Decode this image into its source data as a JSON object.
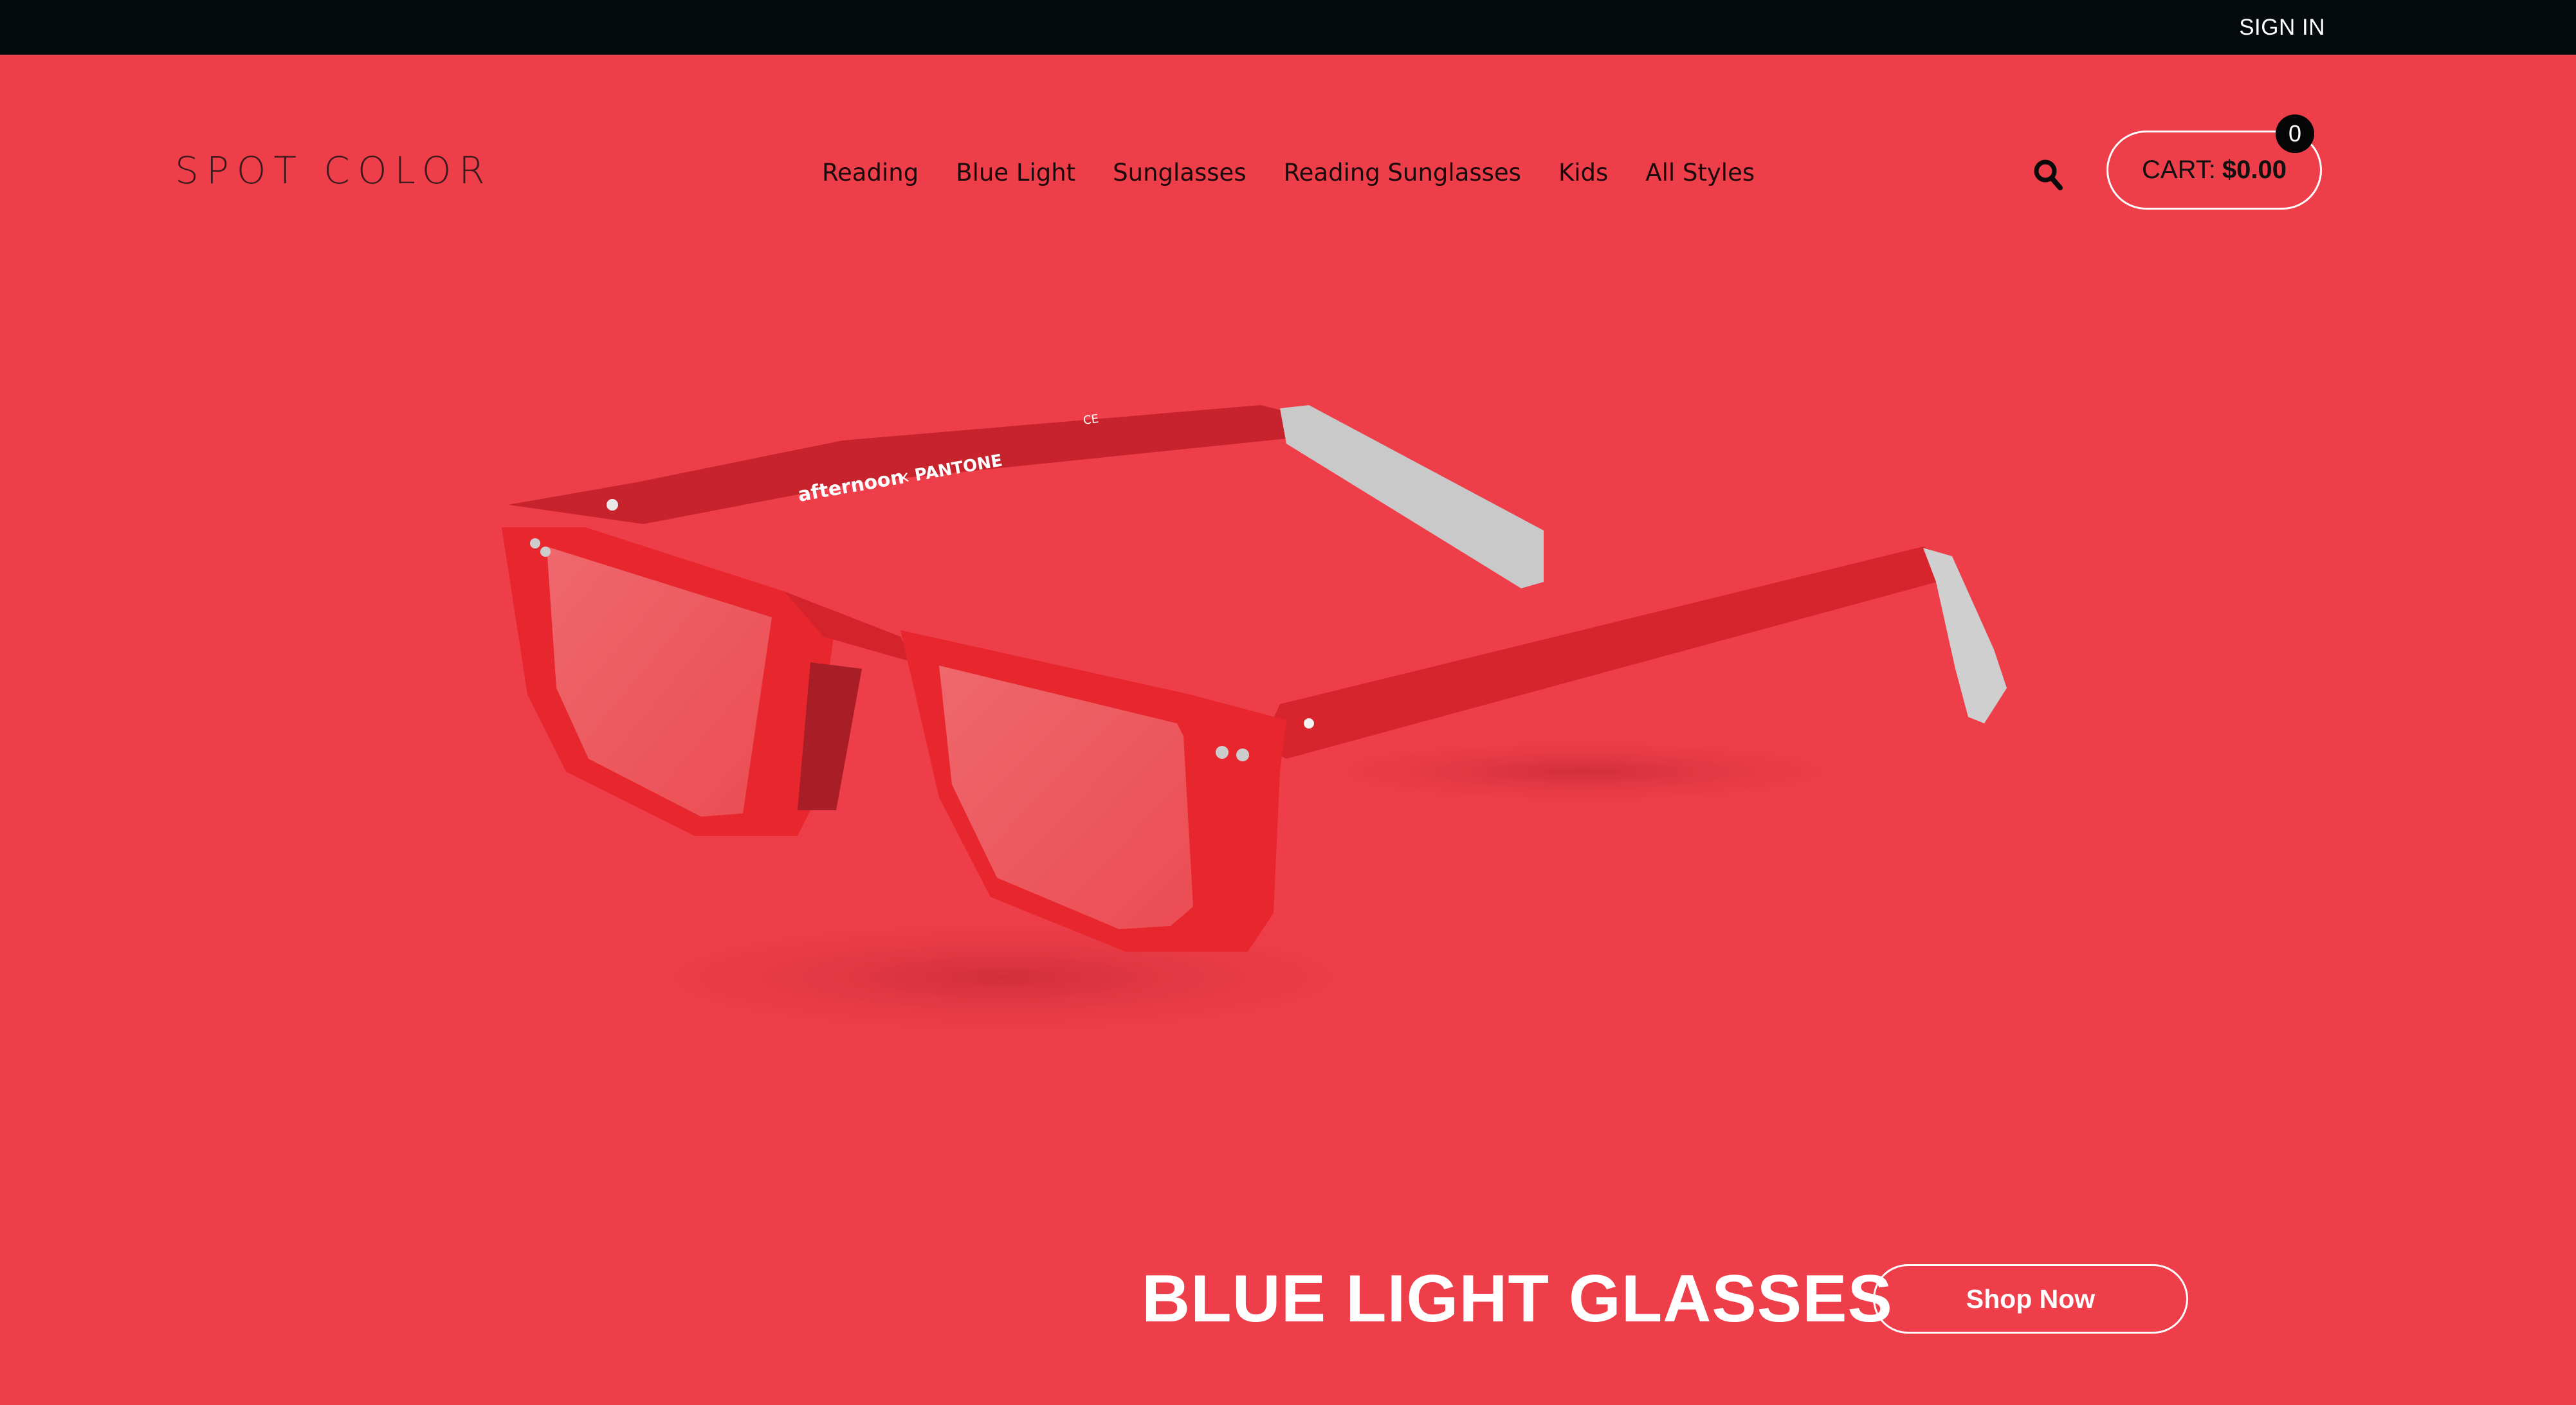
{
  "topbar": {
    "sign_in_label": "SIGN IN"
  },
  "header": {
    "logo_text_before": "SPOT C",
    "logo_text_o": "O",
    "logo_text_after": "LOR",
    "nav": [
      {
        "label": "Reading"
      },
      {
        "label": "Blue Light"
      },
      {
        "label": "Sunglasses"
      },
      {
        "label": "Reading Sunglasses"
      },
      {
        "label": "Kids"
      },
      {
        "label": "All Styles"
      }
    ],
    "search_icon": "search-icon",
    "cart": {
      "label": "CART:",
      "total": "$0.00",
      "count": "0"
    }
  },
  "hero": {
    "product_image": "red-rectangular-eyeglasses",
    "temple_print_brand": "afternoon",
    "temple_print_separator": "×",
    "temple_print_partner": "PANTONE",
    "temple_print_mark": "CE",
    "title": "BLUE LIGHT GLASSES",
    "cta_label": "Shop Now"
  },
  "colors": {
    "background": "#EE3E49",
    "topbar": "#050A0D",
    "frame": "#E8262E",
    "text_dark": "#1A0A0B",
    "white": "#FFFFFF"
  }
}
